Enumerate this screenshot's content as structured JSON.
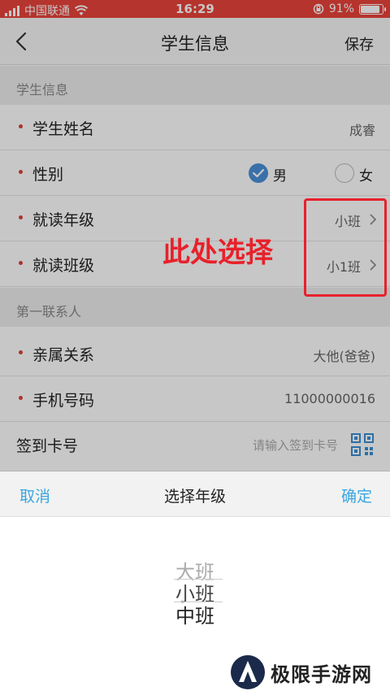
{
  "status_bar": {
    "carrier": "中国联通",
    "time": "16:29",
    "battery_percent": "91%",
    "battery_level": 0.91
  },
  "nav": {
    "title": "学生信息",
    "save_label": "保存"
  },
  "sections": {
    "student": "学生信息",
    "contact": "第一联系人"
  },
  "fields": {
    "name": {
      "label": "学生姓名",
      "value": "成睿"
    },
    "gender": {
      "label": "性别",
      "options": [
        "男",
        "女"
      ],
      "selected": "男"
    },
    "grade": {
      "label": "就读年级",
      "value": "小班"
    },
    "class": {
      "label": "就读班级",
      "value": "小1班"
    },
    "relation": {
      "label": "亲属关系",
      "value": "大他(爸爸)"
    },
    "phone": {
      "label": "手机号码",
      "value": "11000000016"
    },
    "card": {
      "label": "签到卡号",
      "placeholder": "请输入签到卡号"
    }
  },
  "annotation": {
    "text": "此处选择",
    "color": "#e8202a"
  },
  "picker": {
    "cancel_label": "取消",
    "title": "选择年级",
    "confirm_label": "确定",
    "options": [
      "大班",
      "小班",
      "中班"
    ]
  },
  "watermark": {
    "text": "极限手游网"
  },
  "colors": {
    "status_bar": "#e8433a",
    "accent": "#3aa6e0",
    "radio_selected": "#4a90d9",
    "required_star": "#d9423a"
  }
}
